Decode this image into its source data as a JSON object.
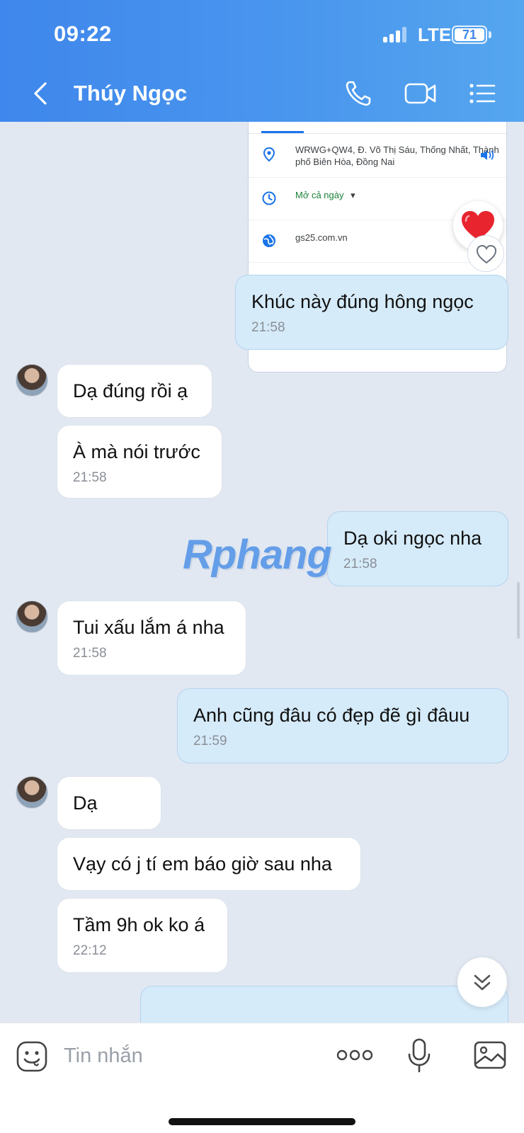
{
  "status_bar": {
    "time": "09:22",
    "network": "LTE",
    "battery": "71"
  },
  "header": {
    "contact_name": "Thúy Ngọc"
  },
  "map_card": {
    "address": "WRWG+QW4, Đ. Võ Thị Sáu, Thống Nhất, Thành phố Biên Hòa, Đồng Nai",
    "hours": "Mở cả ngày",
    "website": "gs25.com.vn"
  },
  "messages": [
    {
      "from": "me",
      "text": "Khúc này đúng hông ngọc",
      "time": "21:58"
    },
    {
      "from": "them",
      "text": "Dạ đúng rồi ạ",
      "time": ""
    },
    {
      "from": "them",
      "text": "À mà nói trước",
      "time": "21:58"
    },
    {
      "from": "me",
      "text": "Dạ oki ngọc nha",
      "time": "21:58"
    },
    {
      "from": "them",
      "text": "Tui xấu lắm á nha",
      "time": "21:58"
    },
    {
      "from": "me",
      "text": "Anh cũng đâu có đẹp đẽ gì đâuu",
      "time": "21:59"
    },
    {
      "from": "them",
      "text": "Dạ",
      "time": ""
    },
    {
      "from": "them",
      "text": "Vạy có j tí em báo giờ sau nha",
      "time": ""
    },
    {
      "from": "them",
      "text": "Tầm 9h ok ko á",
      "time": "22:12"
    }
  ],
  "watermark": {
    "text": "Rphang"
  },
  "input_bar": {
    "placeholder": "Tin nhắn"
  },
  "colors": {
    "header_blue": "#3f87ec",
    "sent_bubble": "#d6ebfa",
    "received_bubble": "#ffffff",
    "chat_background": "#e2e8f1"
  }
}
